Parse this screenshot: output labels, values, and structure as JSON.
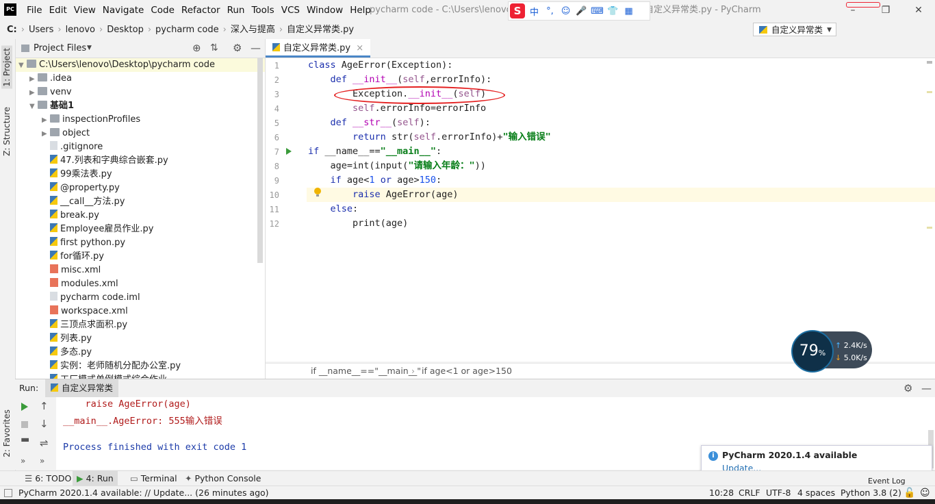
{
  "app": {
    "logo": "PC",
    "window_title": "pycharm code - C:\\Users\\lenovo\\D",
    "window_title_tail": "自定义异常类.py - PyCharm"
  },
  "menu": [
    "File",
    "Edit",
    "View",
    "Navigate",
    "Code",
    "Refactor",
    "Run",
    "Tools",
    "VCS",
    "Window",
    "Help"
  ],
  "ime": {
    "brand": "S",
    "items": [
      "中",
      "°,",
      "☺",
      "🎤",
      "⌨",
      "👕",
      "▦"
    ]
  },
  "breadcrumbs": [
    "C:",
    "Users",
    "lenovo",
    "Desktop",
    "pycharm code",
    "深入与提高",
    "自定义异常类.py"
  ],
  "run_config": "自定义异常类",
  "left_tabs": {
    "project": "1: Project",
    "structure": "Z: Structure",
    "favorites": "2: Favorites"
  },
  "project": {
    "header": "Project Files",
    "root": "C:\\Users\\lenovo\\Desktop\\pycharm code",
    "items": [
      {
        "label": ".idea",
        "type": "folder",
        "arrow": "▶"
      },
      {
        "label": "venv",
        "type": "folder",
        "arrow": "▶"
      },
      {
        "label": "基础1",
        "type": "folder",
        "arrow": "▼"
      },
      {
        "label": "inspectionProfiles",
        "type": "folder",
        "arrow": "▶"
      },
      {
        "label": "object",
        "type": "folder",
        "arrow": "▶"
      },
      {
        "label": ".gitignore",
        "type": "file"
      },
      {
        "label": "47.列表和字典综合嵌套.py",
        "type": "py"
      },
      {
        "label": "99乘法表.py",
        "type": "py"
      },
      {
        "label": "@property.py",
        "type": "py"
      },
      {
        "label": "__call__方法.py",
        "type": "py"
      },
      {
        "label": "break.py",
        "type": "py"
      },
      {
        "label": "Employee雇员作业.py",
        "type": "py"
      },
      {
        "label": "first python.py",
        "type": "py"
      },
      {
        "label": "for循环.py",
        "type": "py"
      },
      {
        "label": "misc.xml",
        "type": "xml"
      },
      {
        "label": "modules.xml",
        "type": "xml"
      },
      {
        "label": "pycharm code.iml",
        "type": "file"
      },
      {
        "label": "workspace.xml",
        "type": "xml"
      },
      {
        "label": "三顶点求面积.py",
        "type": "py"
      },
      {
        "label": "列表.py",
        "type": "py"
      },
      {
        "label": "多态.py",
        "type": "py"
      },
      {
        "label": "实例：老师随机分配办公室.py",
        "type": "py"
      },
      {
        "label": "工厂模式单例模式综合作业",
        "type": "py"
      }
    ]
  },
  "editor": {
    "tab": "自定义异常类.py",
    "tab_close": "×",
    "line_numbers": [
      "1",
      "2",
      "3",
      "4",
      "5",
      "6",
      "7",
      "8",
      "9",
      "10",
      "11",
      "12"
    ],
    "breadcrumb": [
      "if __name__==\"__main__\"",
      "if age<1 or age>150"
    ]
  },
  "run": {
    "label": "Run:",
    "tab": "自定义异常类",
    "console": [
      "    raise AgeError(age)",
      "__main__.AgeError: 555输入错误",
      "",
      "Process finished with exit code 1"
    ]
  },
  "bottom_tabs": [
    "6: TODO",
    "4: Run",
    "Terminal",
    "Python Console"
  ],
  "event_log": "Event Log",
  "status": {
    "message": "PyCharm 2020.1.4 available: // Update... (26 minutes ago)",
    "position": "10:28",
    "line_sep": "CRLF",
    "encoding": "UTF-8",
    "indent": "4 spaces",
    "interpreter": "Python 3.8 (2)"
  },
  "notification": {
    "title": "PyCharm 2020.1.4 available",
    "link": "Update..."
  },
  "net_widget": {
    "percent": "79",
    "percent_unit": "%",
    "up": "2.4",
    "down": "5.0",
    "unit": "K/s",
    "up_arrow": "↑",
    "down_arrow": "↓"
  }
}
